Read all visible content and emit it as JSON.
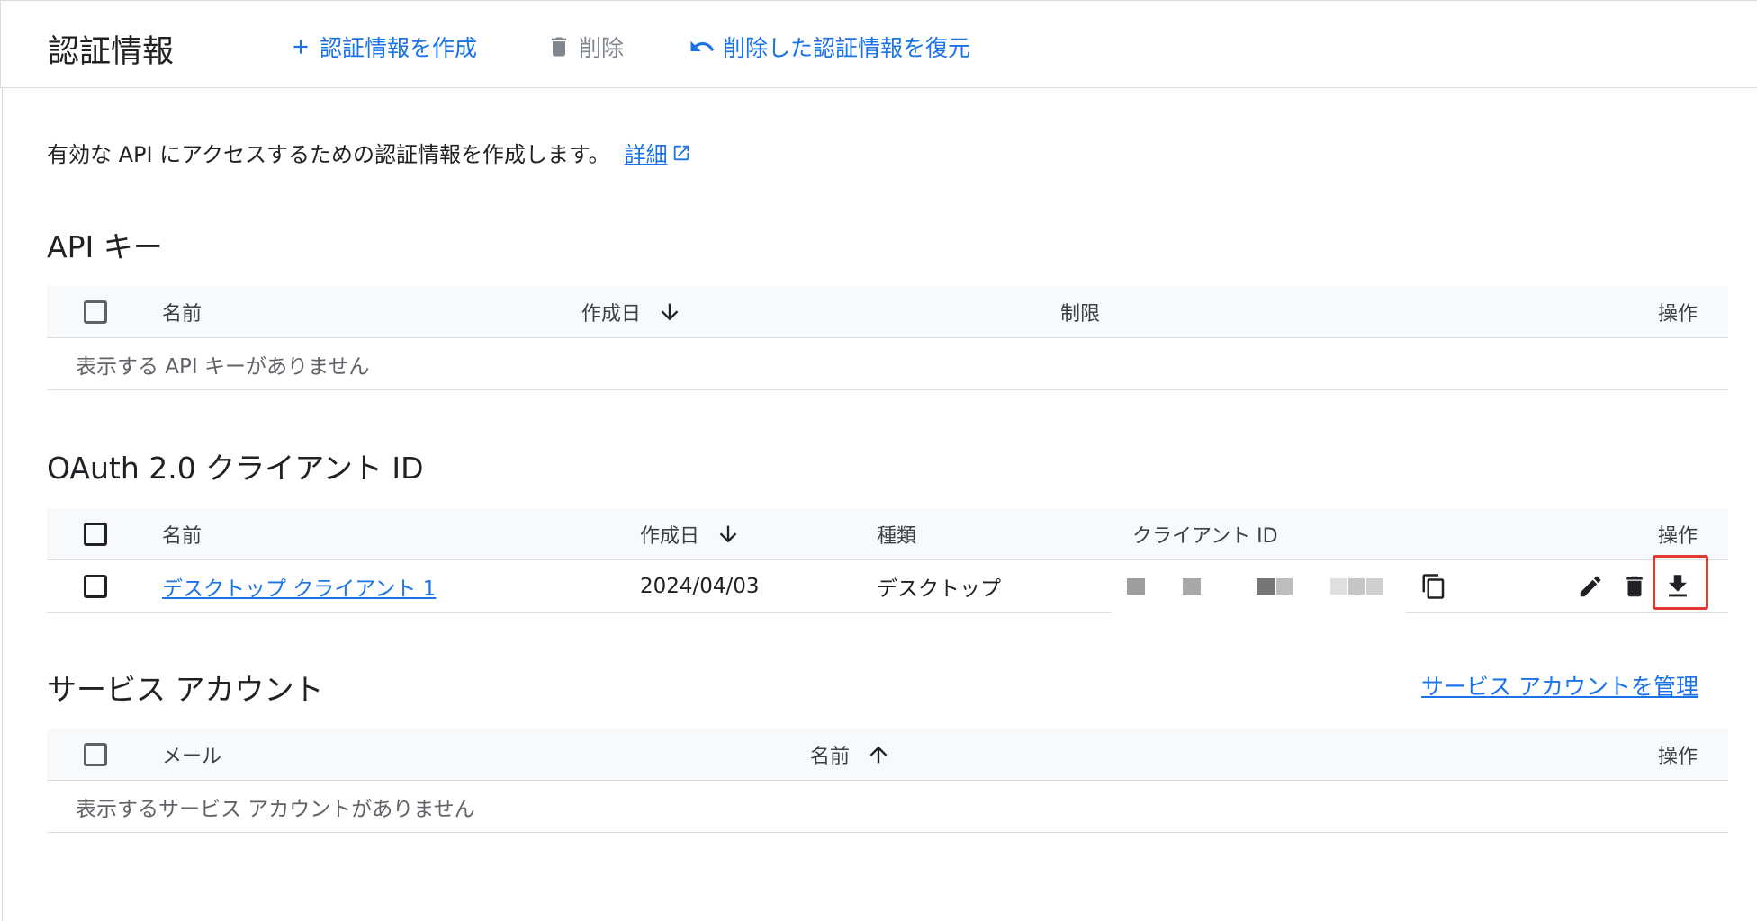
{
  "header": {
    "title": "認証情報",
    "create_label": "認証情報を作成",
    "delete_label": "削除",
    "restore_label": "削除した認証情報を復元"
  },
  "intro": {
    "text": "有効な API にアクセスするための認証情報を作成します。",
    "link_label": "詳細"
  },
  "api_keys": {
    "title": "API キー",
    "columns": {
      "name": "名前",
      "created": "作成日",
      "restriction": "制限",
      "actions": "操作"
    },
    "empty_text": "表示する API キーがありません"
  },
  "oauth": {
    "title": "OAuth 2.0 クライアント ID",
    "columns": {
      "name": "名前",
      "created": "作成日",
      "type": "種類",
      "client_id": "クライアント ID",
      "actions": "操作"
    },
    "rows": [
      {
        "name": "デスクトップ クライアント 1",
        "created": "2024/04/03",
        "type": "デスクトップ"
      }
    ]
  },
  "service_accounts": {
    "title": "サービス アカウント",
    "manage_label": "サービス アカウントを管理",
    "columns": {
      "email": "メール",
      "name": "名前",
      "actions": "操作"
    },
    "empty_text": "表示するサービス アカウントがありません"
  },
  "colors": {
    "accent": "#1a73e8",
    "highlight": "#e53935",
    "muted": "#80868b"
  }
}
